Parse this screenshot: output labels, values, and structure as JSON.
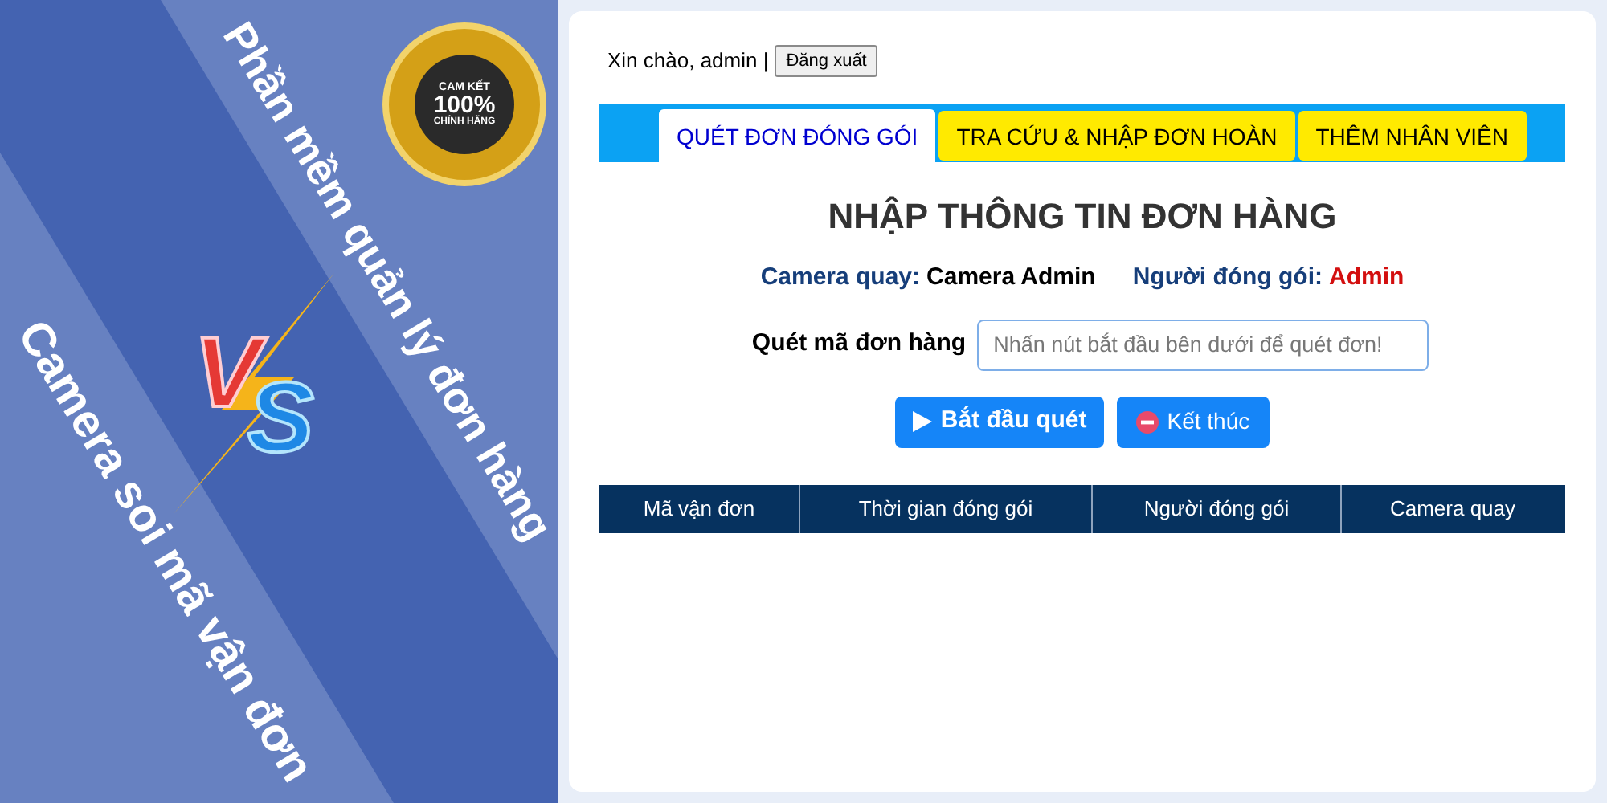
{
  "banner": {
    "headline_top": "Phần mềm quản lý đơn hàng",
    "headline_bottom": "Camera soi mã vận đơn",
    "badge": {
      "line1": "CAM KẾT",
      "line2": "100%",
      "line3": "CHÍNH HÃNG"
    },
    "vs_left": "V",
    "vs_right": "S"
  },
  "header": {
    "greeting": "Xin chào, admin |",
    "logout": "Đăng xuất"
  },
  "tabs": [
    {
      "label": "QUÉT ĐƠN ĐÓNG GÓI",
      "selected": true
    },
    {
      "label": "TRA CỨU & NHẬP ĐƠN HOÀN",
      "selected": false
    },
    {
      "label": "THÊM NHÂN VIÊN",
      "selected": false
    }
  ],
  "heading": "NHẬP THÔNG TIN ĐƠN HÀNG",
  "info": [
    {
      "label": "Camera quay:",
      "value": "Camera Admin",
      "kind": "plain"
    },
    {
      "label": "Người đóng gói:",
      "value": "Admin",
      "kind": "highlight"
    }
  ],
  "scan": {
    "label": "Quét mã đơn hàng",
    "placeholder": "Nhấn nút bắt đầu bên dưới để quét đơn!"
  },
  "buttons": [
    {
      "label": "Bắt đầu quét",
      "kind": "start"
    },
    {
      "label": "Kết thúc",
      "kind": "stop"
    }
  ],
  "table": {
    "columns": [
      "Mã vận đơn",
      "Thời gian đóng gói",
      "Người đóng gói",
      "Camera quay"
    ]
  }
}
